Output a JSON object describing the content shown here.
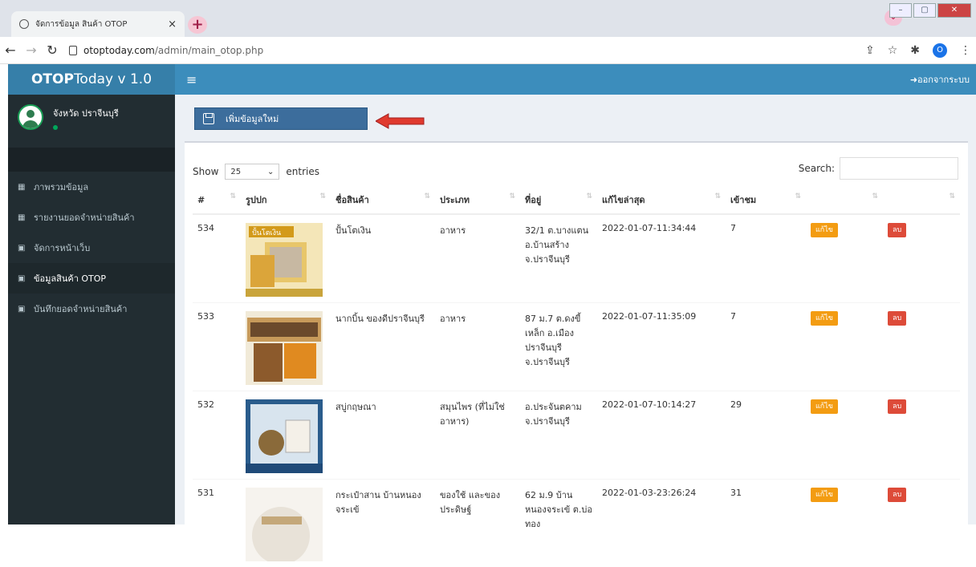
{
  "browser": {
    "tab_title": "จัดการข้อมูล สินค้า OTOP",
    "tab_close": "×",
    "newtab": "+",
    "url_domain": "otoptoday.com",
    "url_path": "/admin/main_otop.php",
    "profile_initial": "O"
  },
  "header": {
    "brand_strong": "OTOP",
    "brand_rest": "Today v 1.0",
    "menu_icon": "≡",
    "logout": "➜ออกจากระบบ"
  },
  "sidebar": {
    "user_name": "จังหวัด ปราจีนบุรี",
    "items": [
      {
        "label": "ภาพรวมข้อมูล"
      },
      {
        "label": "รายงานยอดจำหน่ายสินค้า"
      },
      {
        "label": "จัดการหน้าเว็บ"
      },
      {
        "label": "ข้อมูลสินค้า OTOP"
      },
      {
        "label": "บันทึกยอดจำหน่ายสินค้า"
      }
    ]
  },
  "content": {
    "add_button": "เพิ่มข้อมูลใหม่",
    "show_label": "Show",
    "entries_value": "25",
    "entries_label": "entries",
    "search_label": "Search:"
  },
  "table": {
    "headers": [
      "#",
      "รูปปก",
      "ชื่อสินค้า",
      "ประเภท",
      "ที่อยู่",
      "แก้ไขล่าสุด",
      "เข้าชม"
    ],
    "edit_label": "แก้ไข",
    "delete_label": "ลบ",
    "rows": [
      {
        "id": "534",
        "name": "ปั้นโตเงิน",
        "category": "อาหาร",
        "address": "32/1 ต.บางแตน อ.บ้านสร้าง จ.ปราจีนบุรี",
        "updated": "2022-01-07-11:34:44",
        "views": "7",
        "img_label": "ปั้นโตเงิน"
      },
      {
        "id": "533",
        "name": "นากบิ้น ของดีปราจีนบุรี",
        "category": "อาหาร",
        "address": "87 ม.7 ต.ดงขี้เหล็ก อ.เมือง ปราจีนบุรี จ.ปราจีนบุรี",
        "updated": "2022-01-07-11:35:09",
        "views": "7",
        "img_label": ""
      },
      {
        "id": "532",
        "name": "สบู่กฤษณา",
        "category": "สมุนไพร (ที่ไม่ใช่อาหาร)",
        "address": "อ.ประจันตคาม จ.ปราจีนบุรี",
        "updated": "2022-01-07-10:14:27",
        "views": "29",
        "img_label": ""
      },
      {
        "id": "531",
        "name": "กระเป๋าสาน บ้านหนองจระเข้",
        "category": "ของใช้ และของประดิษฐ์",
        "address": "62 ม.9 บ้านหนองจระเข้ ต.บ่อทอง",
        "updated": "2022-01-03-23:26:24",
        "views": "31",
        "img_label": ""
      }
    ]
  }
}
